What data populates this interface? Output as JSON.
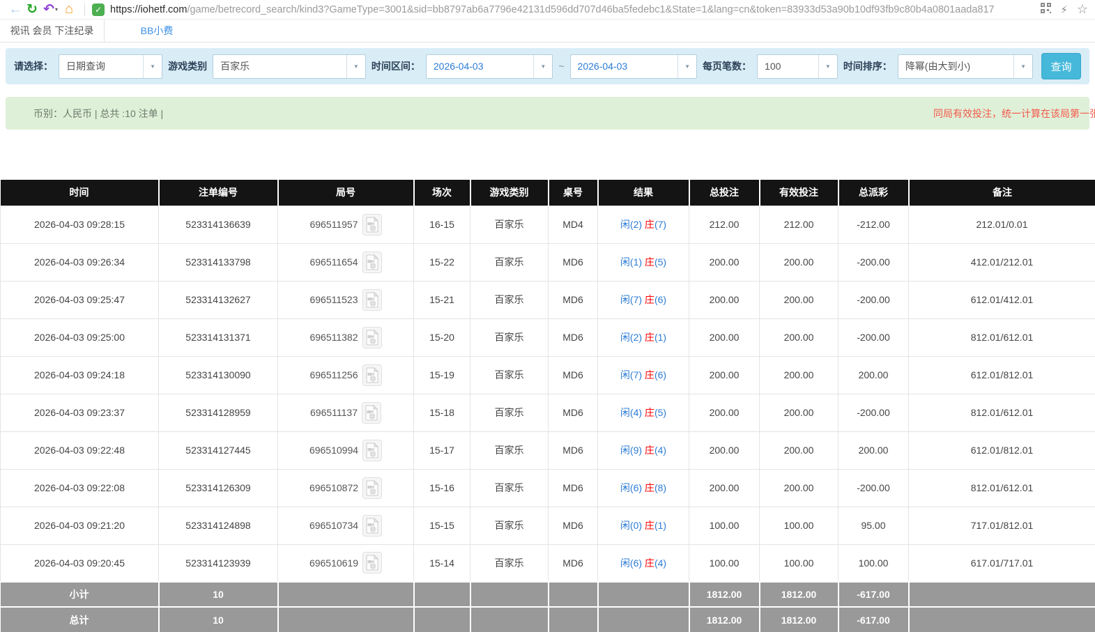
{
  "colors": {
    "accent_blue": "#2b7bd4",
    "negative_red": "#ff0000",
    "header_bg": "#141414",
    "footer_bg": "#999999",
    "filter_bg": "#d9edf7",
    "summary_bg": "#dff0d8",
    "search_button_bg": "#46b8da",
    "note_red": "#f4594a"
  },
  "icons": {
    "back": "←",
    "refresh": "↻",
    "undo": "↶",
    "undo_caret": "▾",
    "home": "⌂",
    "shield_check": "✓",
    "lightning": "⚡",
    "star": "☆",
    "dropdown": "▼"
  },
  "browser": {
    "url_host": "https://iohetf.com",
    "url_path": "/game/betrecord_search/kind3?GameType=3001&sid=bb8797ab6a7796e42131d596dd707d46ba5fedebc1&State=1&lang=cn&token=83933d53a90b10df93fb9c80b4a0801aada817"
  },
  "tabs": {
    "active": "视讯 会员 下注纪录",
    "inactive": "BB小费"
  },
  "filters": {
    "choose_label": "请选择：",
    "choose_value": "日期查询",
    "game_label": "游戏类别",
    "game_value": "百家乐",
    "range_label": "时间区间：",
    "date_from": "2026-04-03",
    "tilde": "~",
    "date_to": "2026-04-03",
    "per_page_label": "每页笔数：",
    "per_page_value": "100",
    "sort_label": "时间排序：",
    "sort_value": "降幂(由大到小)",
    "search_label": "查询"
  },
  "summary": {
    "left": "币别：人民币 | 总共 :10 注单 |",
    "note": "同局有效投注，统一计算在该局第一张"
  },
  "table": {
    "headers": [
      "时间",
      "注单编号",
      "局号",
      "场次",
      "游戏类别",
      "桌号",
      "结果",
      "总投注",
      "有效投注",
      "总派彩",
      "备注"
    ],
    "rows": [
      {
        "time": "2026-04-03 09:28:15",
        "bet_id": "523314136639",
        "round": "696511957",
        "session": "16-15",
        "game": "百家乐",
        "table_no": "MD4",
        "result_player": "闲(2)",
        "result_banker": "庄",
        "result_banker_num": "(7)",
        "total_bet": "212.00",
        "valid_bet": "212.00",
        "payout": "-212.00",
        "payout_negative": true,
        "remark": "212.01/0.01"
      },
      {
        "time": "2026-04-03 09:26:34",
        "bet_id": "523314133798",
        "round": "696511654",
        "session": "15-22",
        "game": "百家乐",
        "table_no": "MD6",
        "result_player": "闲(1)",
        "result_banker": "庄",
        "result_banker_num": "(5)",
        "total_bet": "200.00",
        "valid_bet": "200.00",
        "payout": "-200.00",
        "payout_negative": true,
        "remark": "412.01/212.01"
      },
      {
        "time": "2026-04-03 09:25:47",
        "bet_id": "523314132627",
        "round": "696511523",
        "session": "15-21",
        "game": "百家乐",
        "table_no": "MD6",
        "result_player": "闲(7)",
        "result_banker": "庄",
        "result_banker_num": "(6)",
        "total_bet": "200.00",
        "valid_bet": "200.00",
        "payout": "-200.00",
        "payout_negative": true,
        "remark": "612.01/412.01"
      },
      {
        "time": "2026-04-03 09:25:00",
        "bet_id": "523314131371",
        "round": "696511382",
        "session": "15-20",
        "game": "百家乐",
        "table_no": "MD6",
        "result_player": "闲(2)",
        "result_banker": "庄",
        "result_banker_num": "(1)",
        "total_bet": "200.00",
        "valid_bet": "200.00",
        "payout": "-200.00",
        "payout_negative": true,
        "remark": "812.01/612.01"
      },
      {
        "time": "2026-04-03 09:24:18",
        "bet_id": "523314130090",
        "round": "696511256",
        "session": "15-19",
        "game": "百家乐",
        "table_no": "MD6",
        "result_player": "闲(7)",
        "result_banker": "庄",
        "result_banker_num": "(6)",
        "total_bet": "200.00",
        "valid_bet": "200.00",
        "payout": "200.00",
        "payout_negative": false,
        "remark": "612.01/812.01"
      },
      {
        "time": "2026-04-03 09:23:37",
        "bet_id": "523314128959",
        "round": "696511137",
        "session": "15-18",
        "game": "百家乐",
        "table_no": "MD6",
        "result_player": "闲(4)",
        "result_banker": "庄",
        "result_banker_num": "(5)",
        "total_bet": "200.00",
        "valid_bet": "200.00",
        "payout": "-200.00",
        "payout_negative": true,
        "remark": "812.01/612.01"
      },
      {
        "time": "2026-04-03 09:22:48",
        "bet_id": "523314127445",
        "round": "696510994",
        "session": "15-17",
        "game": "百家乐",
        "table_no": "MD6",
        "result_player": "闲(9)",
        "result_banker": "庄",
        "result_banker_num": "(4)",
        "total_bet": "200.00",
        "valid_bet": "200.00",
        "payout": "200.00",
        "payout_negative": false,
        "remark": "612.01/812.01"
      },
      {
        "time": "2026-04-03 09:22:08",
        "bet_id": "523314126309",
        "round": "696510872",
        "session": "15-16",
        "game": "百家乐",
        "table_no": "MD6",
        "result_player": "闲(6)",
        "result_banker": "庄",
        "result_banker_num": "(8)",
        "total_bet": "200.00",
        "valid_bet": "200.00",
        "payout": "-200.00",
        "payout_negative": true,
        "remark": "812.01/612.01"
      },
      {
        "time": "2026-04-03 09:21:20",
        "bet_id": "523314124898",
        "round": "696510734",
        "session": "15-15",
        "game": "百家乐",
        "table_no": "MD6",
        "result_player": "闲(0)",
        "result_banker": "庄",
        "result_banker_num": "(1)",
        "total_bet": "100.00",
        "valid_bet": "100.00",
        "payout": "95.00",
        "payout_negative": false,
        "remark": "717.01/812.01"
      },
      {
        "time": "2026-04-03 09:20:45",
        "bet_id": "523314123939",
        "round": "696510619",
        "session": "15-14",
        "game": "百家乐",
        "table_no": "MD6",
        "result_player": "闲(6)",
        "result_banker": "庄",
        "result_banker_num": "(4)",
        "total_bet": "100.00",
        "valid_bet": "100.00",
        "payout": "100.00",
        "payout_negative": false,
        "remark": "617.01/717.01"
      }
    ],
    "subtotal": {
      "label": "小计",
      "count": "10",
      "total_bet": "1812.00",
      "valid_bet": "1812.00",
      "payout": "-617.00"
    },
    "total": {
      "label": "总计",
      "count": "10",
      "total_bet": "1812.00",
      "valid_bet": "1812.00",
      "payout": "-617.00"
    }
  }
}
